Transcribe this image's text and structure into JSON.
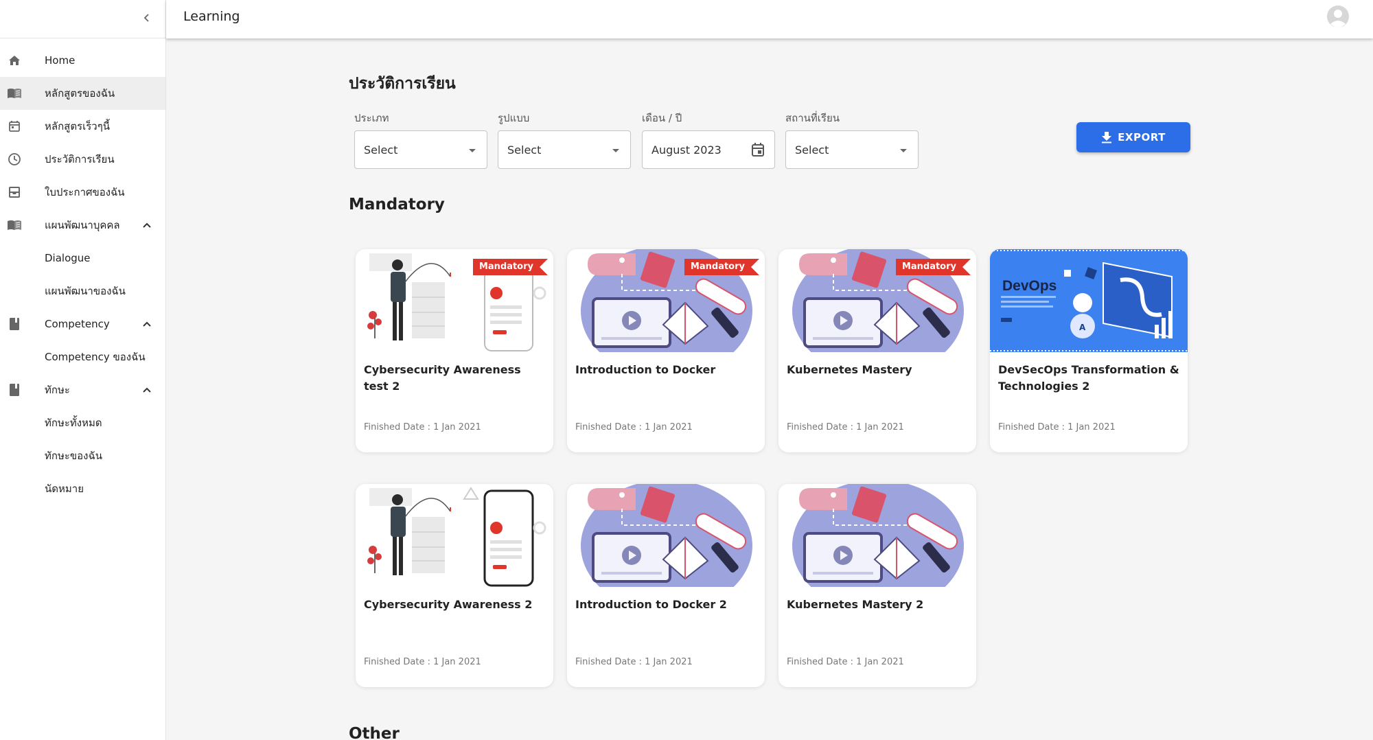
{
  "header": {
    "title": "Learning"
  },
  "sidebar": {
    "items": [
      {
        "label": "Home",
        "icon": "home-icon"
      },
      {
        "label": "หลักสูตรของฉัน",
        "icon": "book-open-icon"
      },
      {
        "label": "หลักสูตรเร็วๆนี้",
        "icon": "calendar-icon"
      },
      {
        "label": "ประวัติการเรียน",
        "icon": "clock-icon"
      },
      {
        "label": "ใบประกาศของฉัน",
        "icon": "inbox-icon"
      },
      {
        "label": "แผนพัฒนาบุคคล",
        "icon": "book-open-icon"
      },
      {
        "label": "Dialogue"
      },
      {
        "label": "แผนพัฒนาของฉัน"
      },
      {
        "label": "Competency",
        "icon": "book-icon"
      },
      {
        "label": "Competency ของฉัน"
      },
      {
        "label": "ทักษะ",
        "icon": "book-icon"
      },
      {
        "label": "ทักษะทั้งหมด"
      },
      {
        "label": "ทักษะของฉัน"
      },
      {
        "label": "นัดหมาย"
      }
    ]
  },
  "page": {
    "title": "ประวัติการเรียน"
  },
  "filters": {
    "type": {
      "label": "ประเภท",
      "value": "Select"
    },
    "format": {
      "label": "รูปแบบ",
      "value": "Select"
    },
    "month_year": {
      "label": "เดือน / ปี",
      "value": "August 2023"
    },
    "location": {
      "label": "สถานที่เรียน",
      "value": "Select"
    }
  },
  "export_label": "EXPORT",
  "sections": {
    "mandatory": "Mandatory",
    "other": "Other"
  },
  "cards": [
    {
      "title": "Cybersecurity Awareness test 2",
      "date": "Finished Date : 1 Jan 2021",
      "badge": "Mandatory",
      "image": "cyber"
    },
    {
      "title": "Introduction to Docker",
      "date": "Finished Date : 1 Jan 2021",
      "badge": "Mandatory",
      "image": "learning"
    },
    {
      "title": "Kubernetes Mastery",
      "date": "Finished Date : 1 Jan 2021",
      "badge": "Mandatory",
      "image": "learning"
    },
    {
      "title": "DevSecOps Transformation & Technologies 2",
      "date": "Finished Date : 1 Jan 2021",
      "image": "devops",
      "image_text": "DevOps"
    },
    {
      "title": "Cybersecurity Awareness 2",
      "date": "Finished Date : 1 Jan 2021",
      "image": "cyber"
    },
    {
      "title": "Introduction to Docker 2",
      "date": "Finished Date : 1 Jan 2021",
      "image": "learning"
    },
    {
      "title": "Kubernetes Mastery 2",
      "date": "Finished Date : 1 Jan 2021",
      "image": "learning"
    }
  ],
  "colors": {
    "accent": "#2b6ee8",
    "badge": "#e0352b",
    "active_nav": "#eeeeee"
  }
}
